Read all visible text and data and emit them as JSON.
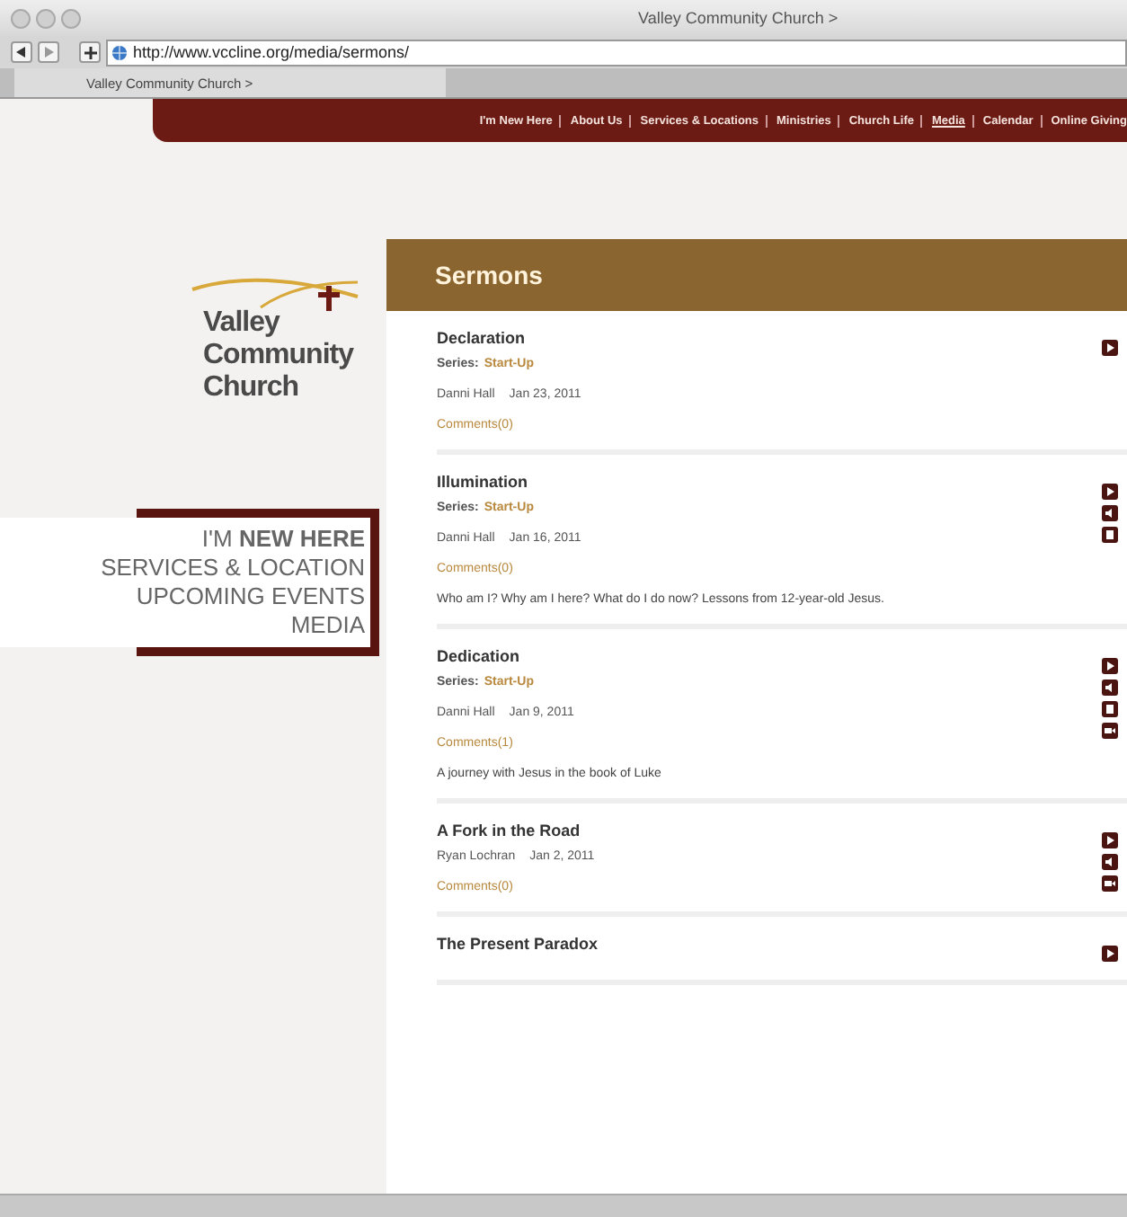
{
  "window": {
    "title": "Valley Community Church >"
  },
  "toolbar": {
    "url": "http://www.vccline.org/media/sermons/"
  },
  "tabs": [
    {
      "label": "Valley Community Church >",
      "selected": true
    }
  ],
  "nav": [
    {
      "label": "I'm New Here",
      "selected": false
    },
    {
      "label": "About Us",
      "selected": false
    },
    {
      "label": "Services & Locations",
      "selected": false
    },
    {
      "label": "Ministries",
      "selected": false
    },
    {
      "label": "Church Life",
      "selected": false
    },
    {
      "label": "Media",
      "selected": true
    },
    {
      "label": "Calendar",
      "selected": false
    },
    {
      "label": "Online Giving",
      "selected": false
    }
  ],
  "logo": {
    "lines": [
      "Valley",
      "Community",
      "Church"
    ]
  },
  "promo_menu": [
    "I'M **NEW HERE**",
    "SERVICES & LOCATION",
    "UPCOMING EVENTS",
    "MEDIA"
  ],
  "section_title": "Sermons",
  "sermons": [
    {
      "title": "Declaration",
      "series_label": "Series:",
      "series": "Start-Up",
      "speaker": "Danni Hall",
      "date": "Jan 23, 2011",
      "comments": "Comments(0)",
      "actions": [
        {
          "kind": "play"
        }
      ]
    },
    {
      "title": "Illumination",
      "series_label": "Series:",
      "series": "Start-Up",
      "speaker": "Danni Hall",
      "date": "Jan 16, 2011",
      "comments": "Comments(0)",
      "description": "Who am I? Why am I here? What do I do now? Lessons from 12-year-old Jesus.",
      "actions": [
        {
          "kind": "play"
        },
        {
          "kind": "audio"
        },
        {
          "kind": "document"
        }
      ]
    },
    {
      "title": "Dedication",
      "series_label": "Series:",
      "series": "Start-Up",
      "speaker": "Danni Hall",
      "date": "Jan 9, 2011",
      "comments": "Comments(1)",
      "description": "A journey with Jesus in the book of Luke",
      "actions": [
        {
          "kind": "play"
        },
        {
          "kind": "audio"
        },
        {
          "kind": "document"
        },
        {
          "kind": "video"
        }
      ]
    },
    {
      "title": "A Fork in the Road",
      "speaker": "Ryan Lochran",
      "date": "Jan 2, 2011",
      "comments": "Comments(0)",
      "actions": [
        {
          "kind": "play"
        },
        {
          "kind": "audio"
        },
        {
          "kind": "video"
        }
      ]
    },
    {
      "title": "The Present Paradox",
      "actions": [
        {
          "kind": "play"
        }
      ]
    }
  ]
}
